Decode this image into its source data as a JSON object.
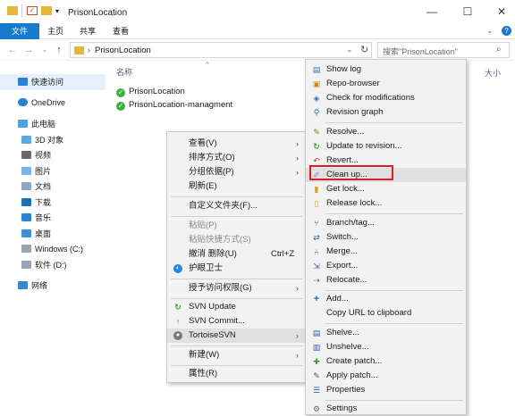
{
  "window": {
    "title": "PrisonLocation"
  },
  "ribbon": {
    "tabs": [
      "文件",
      "主页",
      "共享",
      "查看"
    ]
  },
  "address": {
    "path": "PrisonLocation",
    "search_placeholder": "搜索\"PrisonLocation\""
  },
  "nav": {
    "items": [
      "快速访问",
      "OneDrive",
      "此电脑",
      "3D 对象",
      "视频",
      "图片",
      "文档",
      "下载",
      "音乐",
      "桌面",
      "Windows (C:)",
      "软件 (D:)",
      "网络"
    ]
  },
  "filelist": {
    "col_name": "名称",
    "col_size": "大小",
    "files": [
      "PrisonLocation",
      "PrisonLocation-managment"
    ]
  },
  "context_menu": {
    "items": [
      {
        "label": "查看(V)"
      },
      {
        "label": "排序方式(O)"
      },
      {
        "label": "分组依据(P)"
      },
      {
        "label": "刷新(E)"
      },
      {
        "label": "自定义文件夹(F)..."
      },
      {
        "label": "粘贴(P)"
      },
      {
        "label": "粘贴快捷方式(S)"
      },
      {
        "label": "撤消 删除(U)",
        "shortcut": "Ctrl+Z"
      },
      {
        "label": "护眼卫士"
      },
      {
        "label": "授予访问权限(G)"
      },
      {
        "label": "SVN Update"
      },
      {
        "label": "SVN Commit..."
      },
      {
        "label": "TortoiseSVN"
      },
      {
        "label": "新建(W)"
      },
      {
        "label": "属性(R)"
      }
    ]
  },
  "svn_menu": {
    "items": [
      {
        "label": "Show log"
      },
      {
        "label": "Repo-browser"
      },
      {
        "label": "Check for modifications"
      },
      {
        "label": "Revision graph"
      },
      {
        "label": "Resolve..."
      },
      {
        "label": "Update to revision..."
      },
      {
        "label": "Revert..."
      },
      {
        "label": "Clean up..."
      },
      {
        "label": "Get lock..."
      },
      {
        "label": "Release lock..."
      },
      {
        "label": "Branch/tag..."
      },
      {
        "label": "Switch..."
      },
      {
        "label": "Merge..."
      },
      {
        "label": "Export..."
      },
      {
        "label": "Relocate..."
      },
      {
        "label": "Add..."
      },
      {
        "label": "Copy URL to clipboard"
      },
      {
        "label": "Shelve..."
      },
      {
        "label": "Unshelve..."
      },
      {
        "label": "Create patch..."
      },
      {
        "label": "Apply patch..."
      },
      {
        "label": "Properties"
      },
      {
        "label": "Settings"
      }
    ]
  },
  "colors": {
    "accent": "#1979ca",
    "highlight_border": "#d9202a",
    "menu_bg": "#f2f2f2"
  }
}
